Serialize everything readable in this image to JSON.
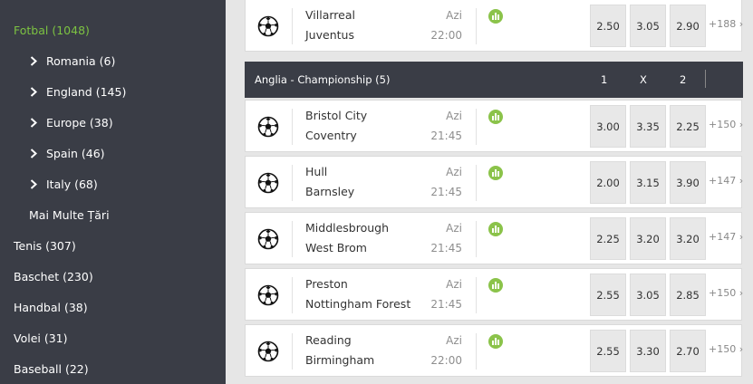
{
  "sidebar": {
    "items": [
      {
        "label": "Fotbal (1048)",
        "level": "top",
        "active": true
      },
      {
        "label": "Romania (6)",
        "level": "sub"
      },
      {
        "label": "England (145)",
        "level": "sub"
      },
      {
        "label": "Europe (38)",
        "level": "sub"
      },
      {
        "label": "Spain (46)",
        "level": "sub"
      },
      {
        "label": "Italy (68)",
        "level": "sub"
      },
      {
        "label": "Mai Multe Țări",
        "level": "more"
      },
      {
        "label": "Tenis (307)",
        "level": "top"
      },
      {
        "label": "Baschet (230)",
        "level": "top"
      },
      {
        "label": "Handbal (38)",
        "level": "top"
      },
      {
        "label": "Volei (31)",
        "level": "top"
      },
      {
        "label": "Baseball (22)",
        "level": "top"
      }
    ]
  },
  "league": {
    "name": "Anglia - Championship (5)",
    "col1": "1",
    "colx": "X",
    "col2": "2"
  },
  "colors": {
    "sidebar_bg": "#3a3d46",
    "accent_green": "#7cc242",
    "stats_green": "#8bc34a"
  },
  "matches": [
    {
      "home": "Villarreal",
      "away": "Juventus",
      "day": "Azi",
      "time": "22:00",
      "odd1": "2.50",
      "oddx": "3.05",
      "odd2": "2.90",
      "more": "+188"
    },
    {
      "home": "Bristol City",
      "away": "Coventry",
      "day": "Azi",
      "time": "21:45",
      "odd1": "3.00",
      "oddx": "3.35",
      "odd2": "2.25",
      "more": "+150"
    },
    {
      "home": "Hull",
      "away": "Barnsley",
      "day": "Azi",
      "time": "21:45",
      "odd1": "2.00",
      "oddx": "3.15",
      "odd2": "3.90",
      "more": "+147"
    },
    {
      "home": "Middlesbrough",
      "away": "West Brom",
      "day": "Azi",
      "time": "21:45",
      "odd1": "2.25",
      "oddx": "3.20",
      "odd2": "3.20",
      "more": "+147"
    },
    {
      "home": "Preston",
      "away": "Nottingham Forest",
      "day": "Azi",
      "time": "21:45",
      "odd1": "2.55",
      "oddx": "3.05",
      "odd2": "2.85",
      "more": "+150"
    },
    {
      "home": "Reading",
      "away": "Birmingham",
      "day": "Azi",
      "time": "22:00",
      "odd1": "2.55",
      "oddx": "3.30",
      "odd2": "2.70",
      "more": "+150"
    }
  ]
}
